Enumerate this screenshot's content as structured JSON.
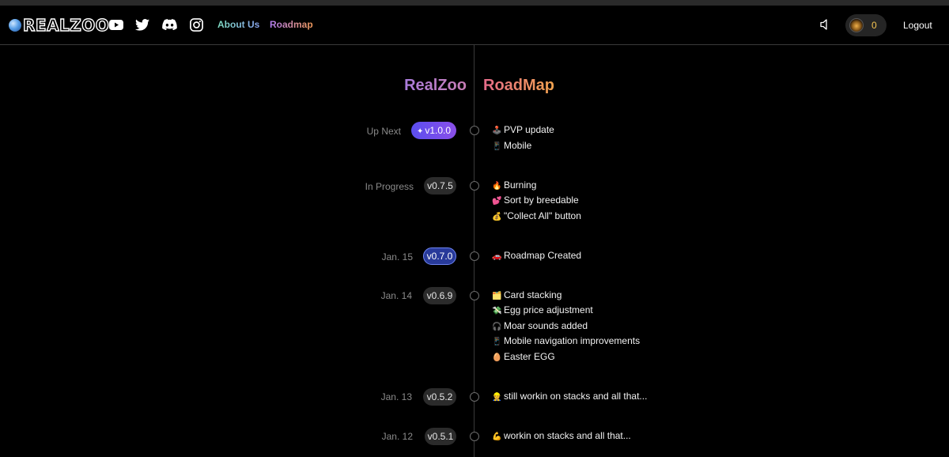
{
  "header": {
    "brand": "REALZOO",
    "nav": {
      "about": "About Us",
      "roadmap": "Roadmap"
    },
    "coin_count": "0",
    "logout": "Logout",
    "social_icons": [
      "youtube-icon",
      "twitter-icon",
      "discord-icon",
      "instagram-icon"
    ]
  },
  "title": {
    "left": "RealZoo",
    "right": "RoadMap"
  },
  "entries": [
    {
      "date": "Up Next",
      "version": "v1.0.0",
      "style": "next",
      "items": [
        {
          "emoji": "🕹️",
          "text": "PVP update"
        },
        {
          "emoji": "📱",
          "text": "Mobile"
        }
      ]
    },
    {
      "date": "In Progress",
      "version": "v0.7.5",
      "style": "default",
      "items": [
        {
          "emoji": "🔥",
          "text": "Burning"
        },
        {
          "emoji": "💕",
          "text": "Sort by breedable"
        },
        {
          "emoji": "💰",
          "text": "\"Collect All\" button"
        }
      ]
    },
    {
      "date": "Jan. 15",
      "version": "v0.7.0",
      "style": "active",
      "items": [
        {
          "emoji": "🚗",
          "text": "Roadmap Created"
        }
      ]
    },
    {
      "date": "Jan. 14",
      "version": "v0.6.9",
      "style": "default",
      "items": [
        {
          "emoji": "🗂️",
          "text": "Card stacking"
        },
        {
          "emoji": "💸",
          "text": "Egg price adjustment"
        },
        {
          "emoji": "🎧",
          "text": "Moar sounds added"
        },
        {
          "emoji": "📱",
          "text": "Mobile navigation improvements"
        },
        {
          "emoji": "🥚",
          "text": "Easter EGG"
        }
      ]
    },
    {
      "date": "Jan. 13",
      "version": "v0.5.2",
      "style": "default",
      "items": [
        {
          "emoji": "👷",
          "text": "still workin on stacks and all that..."
        }
      ]
    },
    {
      "date": "Jan. 12",
      "version": "v0.5.1",
      "style": "default",
      "items": [
        {
          "emoji": "💪",
          "text": "workin on stacks and all that..."
        }
      ]
    }
  ],
  "colors": {
    "accent_purple": "#6a4ff0",
    "active_blue": "#283a9a",
    "coin_gold": "#f5c451"
  }
}
